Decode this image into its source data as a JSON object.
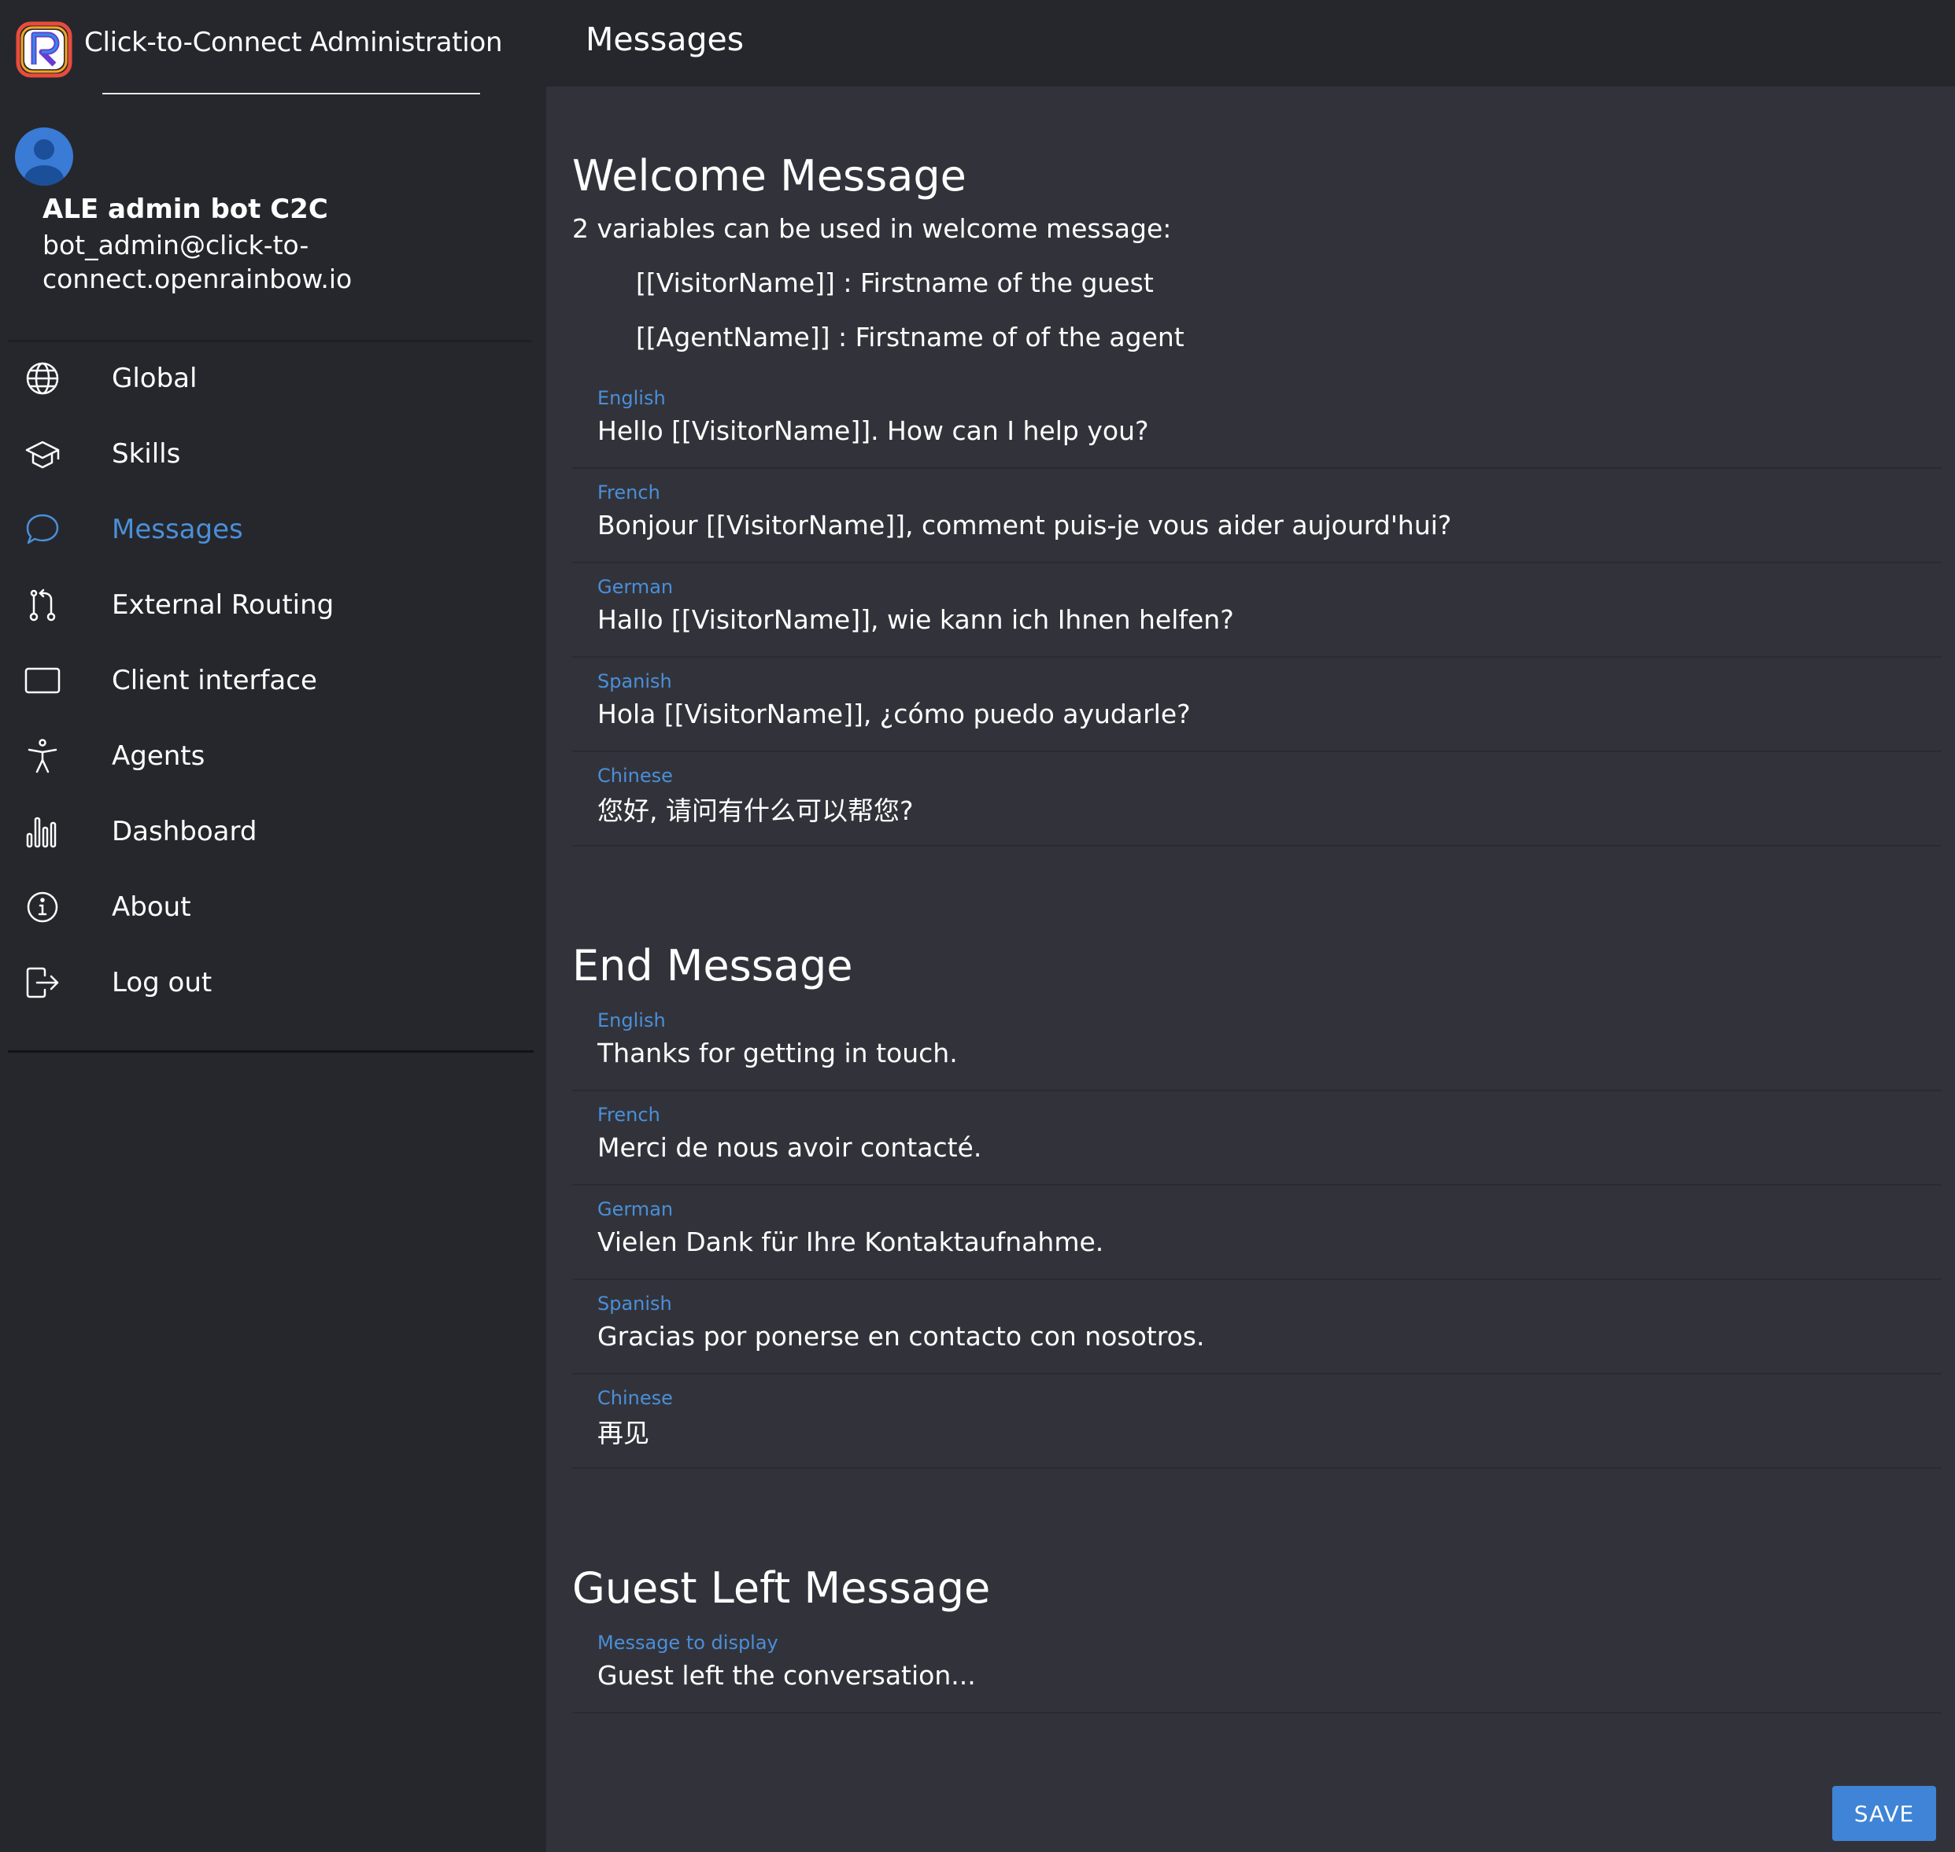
{
  "app": {
    "title": "Click-to-Connect Administration",
    "accent_color": "#4a8fd9"
  },
  "user": {
    "name": "ALE admin bot C2C",
    "email": "bot_admin@click-to-connect.openrainbow.io"
  },
  "nav": {
    "items": [
      {
        "label": "Global",
        "icon": "globe-icon"
      },
      {
        "label": "Skills",
        "icon": "graduation-cap-icon"
      },
      {
        "label": "Messages",
        "icon": "chat-bubble-icon",
        "active": true
      },
      {
        "label": "External Routing",
        "icon": "routing-icon"
      },
      {
        "label": "Client interface",
        "icon": "rectangle-icon"
      },
      {
        "label": "Agents",
        "icon": "accessibility-person-icon"
      },
      {
        "label": "Dashboard",
        "icon": "bar-chart-icon"
      },
      {
        "label": "About",
        "icon": "info-circle-icon"
      },
      {
        "label": "Log out",
        "icon": "logout-icon"
      }
    ]
  },
  "page": {
    "title": "Messages"
  },
  "welcome": {
    "title": "Welcome Message",
    "help": "2 variables can be used in welcome message:",
    "variables": [
      "[[VisitorName]] : Firstname of the guest",
      "[[AgentName]] : Firstname of of the agent"
    ],
    "fields": [
      {
        "label": "English",
        "value": "Hello [[VisitorName]]. How can I help you?"
      },
      {
        "label": "French",
        "value": "Bonjour [[VisitorName]], comment puis-je vous aider aujourd'hui?"
      },
      {
        "label": "German",
        "value": "Hallo [[VisitorName]], wie kann ich Ihnen helfen?"
      },
      {
        "label": "Spanish",
        "value": "Hola [[VisitorName]], ¿cómo puedo ayudarle?"
      },
      {
        "label": "Chinese",
        "value": "您好, 请问有什么可以帮您?"
      }
    ]
  },
  "end": {
    "title": "End Message",
    "fields": [
      {
        "label": "English",
        "value": "Thanks for getting in touch."
      },
      {
        "label": "French",
        "value": "Merci de nous avoir contacté."
      },
      {
        "label": "German",
        "value": "Vielen Dank für Ihre Kontaktaufnahme."
      },
      {
        "label": "Spanish",
        "value": "Gracias por ponerse en contacto con nosotros."
      },
      {
        "label": "Chinese",
        "value": "再见"
      }
    ]
  },
  "guest_left": {
    "title": "Guest Left Message",
    "fields": [
      {
        "label": "Message to display",
        "value": "Guest left the conversation..."
      }
    ]
  },
  "actions": {
    "save_label": "SAVE"
  }
}
